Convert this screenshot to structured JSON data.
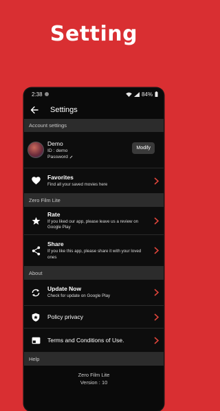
{
  "banner": {
    "title": "Setting"
  },
  "status_bar": {
    "time": "2:38",
    "battery": "84%"
  },
  "toolbar": {
    "title": "Settings"
  },
  "sections": {
    "account": "Account settings",
    "app": "Zero Film Lite",
    "about": "About",
    "help": "Help"
  },
  "account": {
    "name": "Demo",
    "id": "ID : demo",
    "password": "Password",
    "modify_label": "Modify"
  },
  "items": {
    "favorites": {
      "title": "Favorites",
      "subtitle": "Find all your saved movies here"
    },
    "rate": {
      "title": "Rate",
      "subtitle": "If you liked our app, please leave us a review on Google Play"
    },
    "share": {
      "title": "Share",
      "subtitle": "If you like this app, please share it with your loved ones"
    },
    "update": {
      "title": "Update Now",
      "subtitle": "Check for update on Google Play"
    },
    "policy": {
      "title": "Policy privacy"
    },
    "terms": {
      "title": "Terms and Conditions of Use."
    }
  },
  "footer": {
    "app_name": "Zero Film Lite",
    "version": "Version : 10"
  },
  "colors": {
    "background": "#d92f32",
    "accent": "#e0453b",
    "surface": "#0d0d0d",
    "section": "#2c2c2c"
  },
  "icons": [
    "back-arrow-icon",
    "heart-icon",
    "star-icon",
    "share-icon",
    "sync-icon",
    "shield-icon",
    "card-icon",
    "chevron-right-icon",
    "pencil-icon"
  ]
}
